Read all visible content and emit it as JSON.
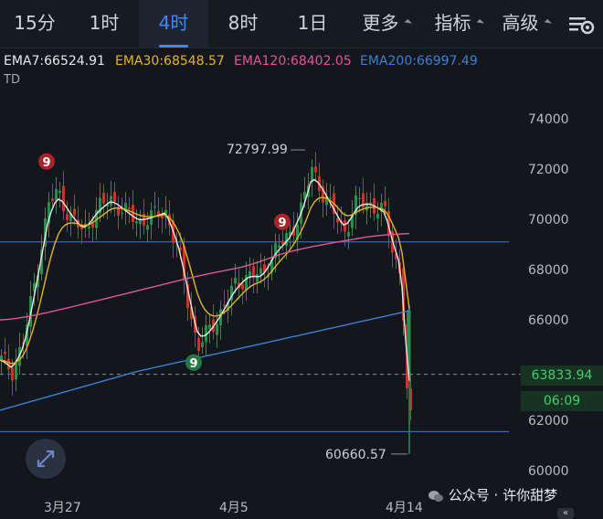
{
  "tabs": [
    {
      "label": "15分"
    },
    {
      "label": "1时"
    },
    {
      "label": "4时",
      "active": true
    },
    {
      "label": "8时"
    },
    {
      "label": "1日"
    },
    {
      "label": "更多"
    },
    {
      "label": "指标"
    },
    {
      "label": "高级"
    }
  ],
  "settings_icon": "chart-settings-icon",
  "indicators": {
    "ema7": "EMA7:66524.91",
    "ema30": "EMA30:68548.57",
    "ema120": "EMA120:68402.05",
    "ema200": "EMA200:66997.49",
    "td": "TD"
  },
  "colors": {
    "ema7": "#e8e8e8",
    "ema30": "#e5b420",
    "ema120": "#e0559a",
    "ema200": "#3b7fd6",
    "up": "#2e8b4f",
    "down": "#c0392b",
    "accent": "#3b8cf2"
  },
  "chart_data": {
    "type": "candlestick",
    "y_axis": {
      "min": 60000,
      "max": 74000,
      "ticks": [
        "74000",
        "72000",
        "70000",
        "68000",
        "66000",
        "62000",
        "60000"
      ]
    },
    "x_axis": {
      "ticks": [
        "3月27",
        "4月5",
        "4月14"
      ]
    },
    "annotations": {
      "high": "72797.99",
      "low": "60660.57"
    },
    "td_markers": [
      {
        "label": "9",
        "type": "sell"
      },
      {
        "label": "9",
        "type": "sell"
      },
      {
        "label": "9",
        "type": "buy"
      }
    ],
    "horizontal_levels": [
      69100,
      63833.94,
      61550
    ],
    "current_price": "63833.94",
    "countdown": "06:09",
    "ema_values": {
      "EMA7": 66524.91,
      "EMA30": 68548.57,
      "EMA120": 68402.05,
      "EMA200": 66997.49
    }
  },
  "watermark": "公众号 · 许你甜梦"
}
